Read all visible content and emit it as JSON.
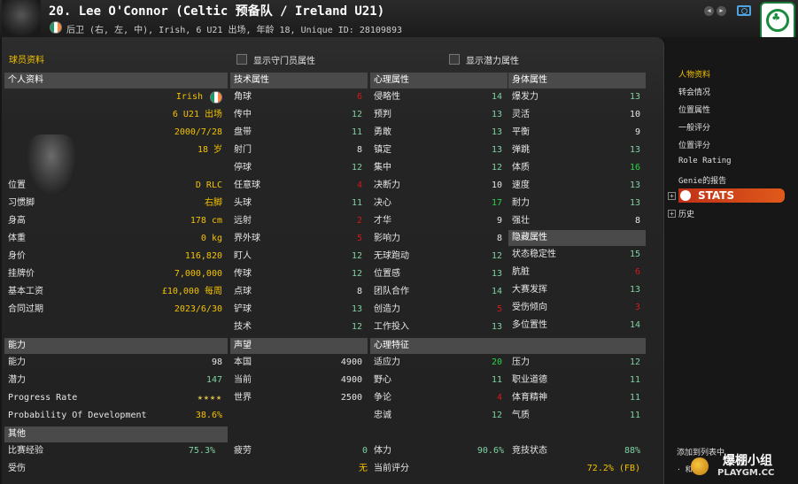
{
  "header": {
    "title": "20. Lee O'Connor (Celtic 预备队 / Ireland U21)",
    "subtitle": "后卫 (右, 左, 中), Irish, 6 U21 出场, 年龄 18, Unique ID: 28109893"
  },
  "options": {
    "section_title": "球员资料",
    "show_gk_attrs": "显示守门员属性",
    "show_potential_attrs": "显示潜力属性"
  },
  "personal": {
    "head": "个人资料",
    "nationality": "Irish",
    "caps": "6 U21 出场",
    "dob": "2000/7/28",
    "age": "18 岁",
    "rows": [
      {
        "label": "位置",
        "value": "D RLC"
      },
      {
        "label": "习惯脚",
        "value": "右脚"
      },
      {
        "label": "身高",
        "value": "178 cm"
      },
      {
        "label": "体重",
        "value": "0 kg"
      },
      {
        "label": "身价",
        "value": "116,820"
      },
      {
        "label": "挂牌价",
        "value": "7,000,000"
      },
      {
        "label": "基本工资",
        "value": "£10,000 每周"
      },
      {
        "label": "合同过期",
        "value": "2023/6/30"
      }
    ]
  },
  "technical": {
    "head": "技术属性",
    "rows": [
      {
        "label": "角球",
        "value": "6"
      },
      {
        "label": "传中",
        "value": "12"
      },
      {
        "label": "盘带",
        "value": "11"
      },
      {
        "label": "射门",
        "value": "8"
      },
      {
        "label": "停球",
        "value": "12"
      },
      {
        "label": "任意球",
        "value": "4"
      },
      {
        "label": "头球",
        "value": "11"
      },
      {
        "label": "远射",
        "value": "2"
      },
      {
        "label": "界外球",
        "value": "5"
      },
      {
        "label": "盯人",
        "value": "12"
      },
      {
        "label": "传球",
        "value": "12"
      },
      {
        "label": "点球",
        "value": "8"
      },
      {
        "label": "铲球",
        "value": "13"
      },
      {
        "label": "技术",
        "value": "12"
      }
    ]
  },
  "mental": {
    "head": "心理属性",
    "rows": [
      {
        "label": "侵略性",
        "value": "14"
      },
      {
        "label": "预判",
        "value": "13"
      },
      {
        "label": "勇敢",
        "value": "13"
      },
      {
        "label": "镇定",
        "value": "13"
      },
      {
        "label": "集中",
        "value": "12"
      },
      {
        "label": "决断力",
        "value": "10"
      },
      {
        "label": "决心",
        "value": "17"
      },
      {
        "label": "才华",
        "value": "9"
      },
      {
        "label": "影响力",
        "value": "8"
      },
      {
        "label": "无球跑动",
        "value": "12"
      },
      {
        "label": "位置感",
        "value": "13"
      },
      {
        "label": "团队合作",
        "value": "14"
      },
      {
        "label": "创造力",
        "value": "5"
      },
      {
        "label": "工作投入",
        "value": "13"
      }
    ]
  },
  "physical": {
    "head": "身体属性",
    "rows": [
      {
        "label": "爆发力",
        "value": "13"
      },
      {
        "label": "灵活",
        "value": "10"
      },
      {
        "label": "平衡",
        "value": "9"
      },
      {
        "label": "弹跳",
        "value": "13"
      },
      {
        "label": "体质",
        "value": "16"
      },
      {
        "label": "速度",
        "value": "13"
      },
      {
        "label": "耐力",
        "value": "13"
      },
      {
        "label": "强壮",
        "value": "8"
      }
    ]
  },
  "hidden": {
    "head": "隐藏属性",
    "rows": [
      {
        "label": "状态稳定性",
        "value": "15"
      },
      {
        "label": "肮脏",
        "value": "6"
      },
      {
        "label": "大赛发挥",
        "value": "13"
      },
      {
        "label": "受伤倾向",
        "value": "3"
      },
      {
        "label": "多位置性",
        "value": "14"
      }
    ]
  },
  "ability": {
    "head": "能力",
    "ca_label": "能力",
    "ca": "98",
    "pa_label": "潜力",
    "pa": "147",
    "prog_label": "Progress Rate",
    "prog_stars": 4,
    "pod_label": "Probability Of Development",
    "pod": "38.6%"
  },
  "reputation": {
    "head": "声望",
    "rows": [
      {
        "label": "本国",
        "value": "4900"
      },
      {
        "label": "当前",
        "value": "4900"
      },
      {
        "label": "世界",
        "value": "2500"
      }
    ]
  },
  "traits": {
    "head": "心理特征",
    "rows": [
      {
        "label": "适应力",
        "value": "20",
        "label2": "压力",
        "value2": "12"
      },
      {
        "label": "野心",
        "value": "11",
        "label2": "职业道德",
        "value2": "11"
      },
      {
        "label": "争论",
        "value": "4",
        "label2": "体育精神",
        "value2": "11"
      },
      {
        "label": "忠诚",
        "value": "12",
        "label2": "气质",
        "value2": "11"
      }
    ]
  },
  "other": {
    "head": "其他",
    "exp_label": "比赛经验",
    "exp": "75.3%",
    "fatigue_label": "疲劳",
    "fatigue": "0",
    "stamina_label": "体力",
    "stamina": "90.6%",
    "match_label": "竞技状态",
    "match": "88%",
    "injury_label": "受伤",
    "injury": "无",
    "rating_label": "当前评分",
    "rating": "72.2% (FB)"
  },
  "sidebar": {
    "items": [
      "人物资料",
      "转会情况",
      "位置属性",
      "一般评分",
      "位置评分",
      "Role Rating",
      "Genie的报告"
    ],
    "stats": "STATS",
    "history": "历史"
  },
  "watermark": {
    "line1": "添加到列表中",
    "line2": "· 和",
    "brand": "爆棚小组",
    "site": "PLAYGM.CC"
  }
}
